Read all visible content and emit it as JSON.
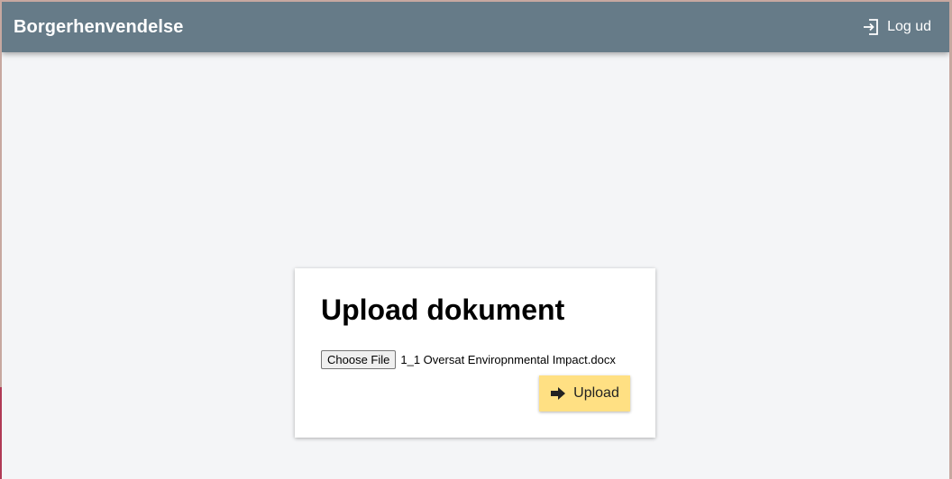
{
  "header": {
    "title": "Borgerhenvendelse",
    "logout_label": "Log ud",
    "logout_icon": "logout-icon",
    "background_color": "#667b88"
  },
  "card": {
    "title": "Upload dokument",
    "file_input": {
      "button_label": "Choose File",
      "selected_file": "1_1 Oversat Enviropnmental Impact.docx"
    },
    "upload_button": {
      "label": "Upload",
      "icon": "arrow-right-icon",
      "color": "#ffe083"
    }
  }
}
